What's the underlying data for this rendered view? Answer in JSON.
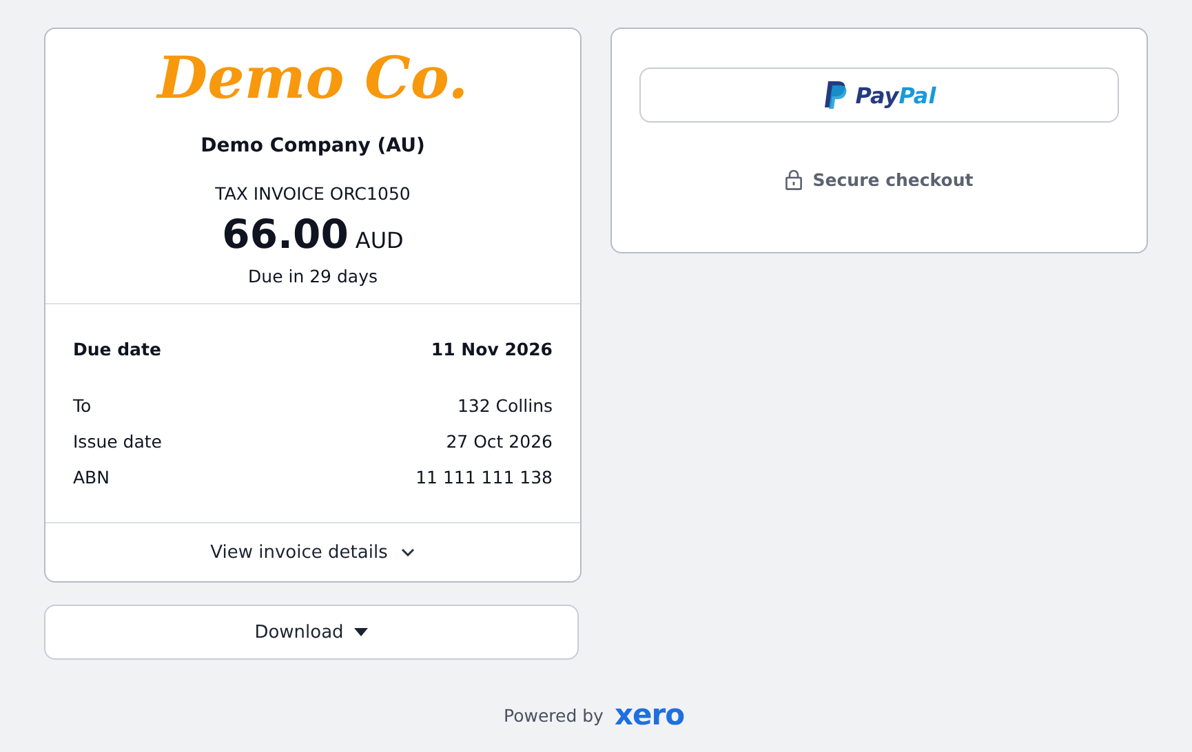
{
  "invoice": {
    "logo": "Demo Co.",
    "company": "Demo Company (AU)",
    "title": "TAX INVOICE ORC1050",
    "amount": "66.00",
    "currency": "AUD",
    "due_note": "Due in 29 days",
    "details": [
      {
        "label": "Due date",
        "value": "11 Nov 2026",
        "kind": "bold"
      },
      {
        "label": "To",
        "value": "132 Collins",
        "kind": "plain"
      },
      {
        "label": "Issue date",
        "value": "27 Oct 2026",
        "kind": "plain"
      },
      {
        "label": "ABN",
        "value": "11 111 111 138",
        "kind": "plain"
      }
    ],
    "details_toggle": {
      "label": "View invoice details",
      "expanded": false
    }
  },
  "download": {
    "label": "Download"
  },
  "payment": {
    "paypal_label": [
      "Pay",
      "Pal"
    ],
    "secure": "Secure checkout"
  },
  "footer": {
    "powered": "Powered by",
    "brand": "xero"
  }
}
